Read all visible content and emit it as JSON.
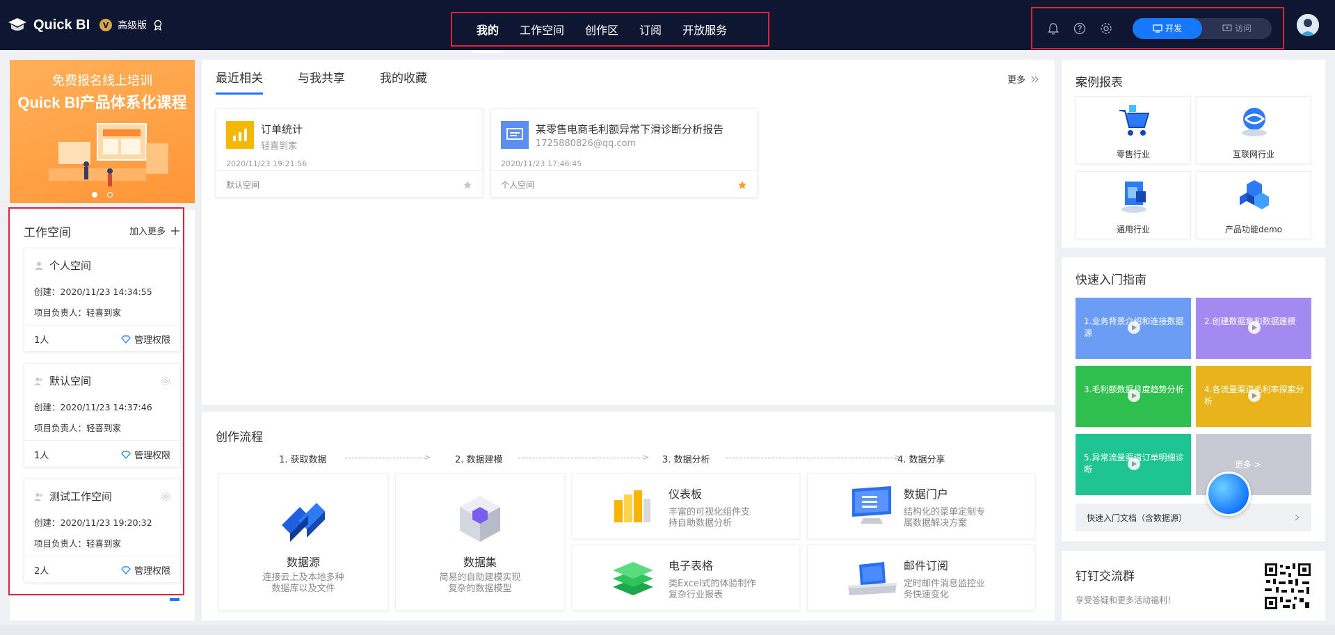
{
  "header": {
    "logo_text": "Quick BI",
    "edition_badge": "V",
    "edition_text": "高级版",
    "nav": [
      "我的",
      "工作空间",
      "创作区",
      "订阅",
      "开放服务"
    ],
    "active_nav": 0,
    "mode_dev": "开发",
    "mode_visit": "访问"
  },
  "banner": {
    "line1": "免费报名线上培训",
    "line2": "Quick BI产品体系化课程"
  },
  "workspace": {
    "title": "工作空间",
    "add_more": "加入更多",
    "items": [
      {
        "name": "个人空间",
        "created": "创建：2020/11/23 14:34:55",
        "owner": "项目负责人：轻喜到家",
        "members": "1人",
        "perm": "管理权限"
      },
      {
        "name": "默认空间",
        "created": "创建：2020/11/23 14:37:46",
        "owner": "项目负责人：轻喜到家",
        "members": "1人",
        "perm": "管理权限"
      },
      {
        "name": "测试工作空间",
        "created": "创建：2020/11/23 19:20:32",
        "owner": "项目负责人：轻喜到家",
        "members": "2人",
        "perm": "管理权限"
      }
    ]
  },
  "recent": {
    "tabs": [
      "最近相关",
      "与我共享",
      "我的收藏"
    ],
    "more": "更多",
    "cards": [
      {
        "title": "订单统计",
        "sub": "轻喜到家",
        "time": "2020/11/23 19:21:56",
        "space": "默认空间",
        "starred": false
      },
      {
        "title": "某零售电商毛利额异常下滑诊断分析报告",
        "sub": "1725880826@qq.com",
        "time": "2020/11/23 17:46:45",
        "space": "个人空间",
        "starred": true
      }
    ]
  },
  "flow": {
    "title": "创作流程",
    "steps": [
      "1. 获取数据",
      "2. 数据建模",
      "3. 数据分析",
      "4. 数据分享"
    ],
    "cards": {
      "datasource": {
        "name": "数据源",
        "desc1": "连接云上及本地多种",
        "desc2": "数据库以及文件"
      },
      "dataset": {
        "name": "数据集",
        "desc1": "简易的自助建模实现",
        "desc2": "复杂的数据模型"
      },
      "dashboard": {
        "name": "仪表板",
        "desc1": "丰富的可视化组件支",
        "desc2": "持自助数据分析"
      },
      "portal": {
        "name": "数据门户",
        "desc1": "结构化的菜单定制专",
        "desc2": "属数据解决方案"
      },
      "spreadsheet": {
        "name": "电子表格",
        "desc1": "类Excel式的体验制作",
        "desc2": "复杂行业报表"
      },
      "mail": {
        "name": "邮件订阅",
        "desc1": "定时邮件消息监控业",
        "desc2": "务快速变化"
      }
    }
  },
  "cases": {
    "title": "案例报表",
    "items": [
      "零售行业",
      "互联网行业",
      "通用行业",
      "产品功能demo"
    ]
  },
  "guide": {
    "title": "快速入门指南",
    "tiles": [
      {
        "text": "1.业务背景介绍和连接数据源",
        "color": "#6b9df5"
      },
      {
        "text": "2.创建数据集和数据建模",
        "color": "#a38af0"
      },
      {
        "text": "3.毛利额数据月度趋势分析",
        "color": "#2fbf4e"
      },
      {
        "text": "4.各流量渠道毛利率探索分析",
        "color": "#e8b31b"
      },
      {
        "text": "5.异常流量渠道订单明细诊断",
        "color": "#1fc493"
      },
      {
        "text": "更多 >",
        "color": "#c8c9d3"
      }
    ],
    "doc_link": "快速入门文档（含数据源）"
  },
  "ding": {
    "title": "钉钉交流群",
    "sub": "享受答疑和更多活动福利！"
  }
}
